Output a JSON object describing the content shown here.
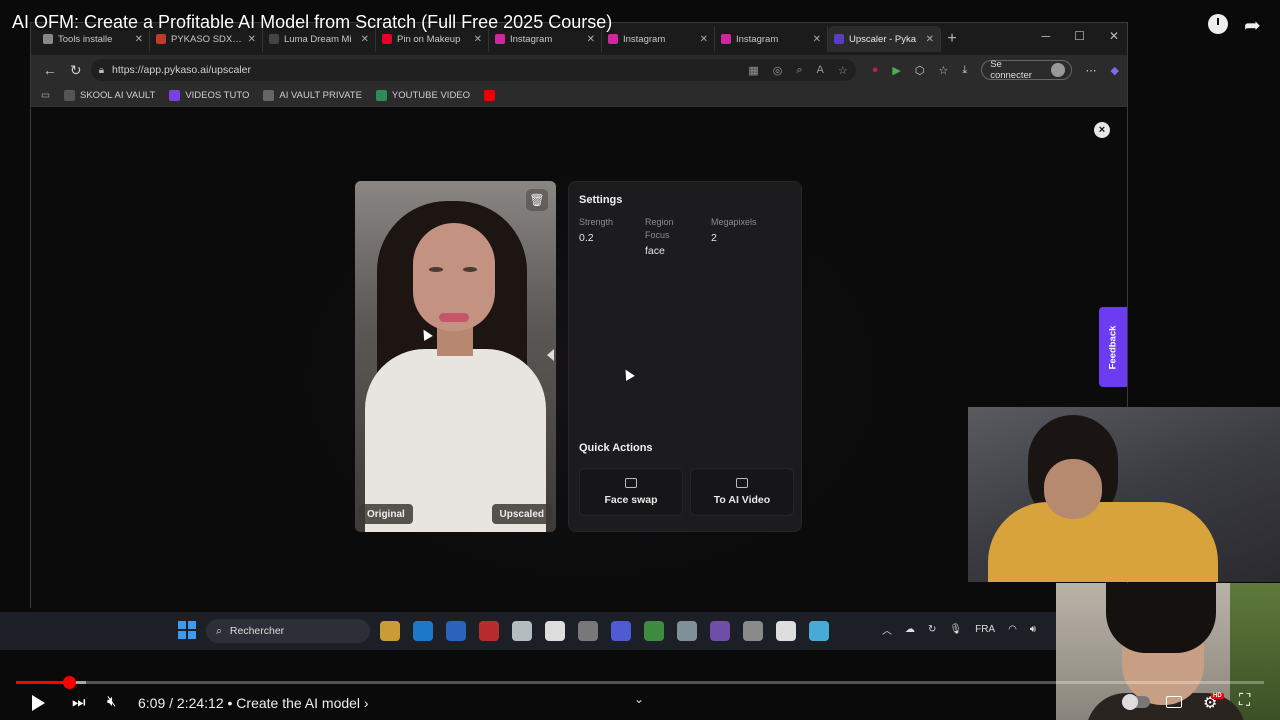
{
  "video": {
    "title": "AI OFM: Create a Profitable AI Model from Scratch (Full Free 2025 Course)",
    "time": "6:09 / 2:24:12 • Create the AI model ›",
    "progress_fraction": 0.0426,
    "buffer_fraction": 0.056,
    "hd_badge": "HD"
  },
  "browser": {
    "tabs": [
      {
        "label": "Tools installe",
        "color": "#888"
      },
      {
        "label": "PYKASO SDXL G",
        "color": "#c0392b"
      },
      {
        "label": "Luma Dream Mi",
        "color": "#444"
      },
      {
        "label": "Pin on Makeup",
        "color": "#e60023"
      },
      {
        "label": "Instagram",
        "color": "#d6249f"
      },
      {
        "label": "Instagram",
        "color": "#d6249f"
      },
      {
        "label": "Instagram",
        "color": "#d6249f"
      },
      {
        "label": "Upscaler - Pyka",
        "color": "#5b3cc4"
      }
    ],
    "url": "https://app.pykaso.ai/upscaler",
    "signin_label": "Se connecter",
    "bookmarks": [
      {
        "label": "SKOOL AI VAULT",
        "color": "#555"
      },
      {
        "label": "VIDEOS TUTO",
        "color": "#7b3fe4"
      },
      {
        "label": "AI VAULT PRIVATE",
        "color": "#666"
      },
      {
        "label": "YOUTUBE VIDEO",
        "color": "#2e8b57"
      },
      {
        "label": "",
        "color": "#e00"
      }
    ]
  },
  "upscaler": {
    "image_tags": {
      "original": "Original",
      "upscaled": "Upscaled"
    },
    "settings": {
      "title": "Settings",
      "strength_label": "Strength",
      "strength_value": "0.2",
      "region_label": "Region Focus",
      "region_value": "face",
      "megapixels_label": "Megapixels",
      "megapixels_value": "2"
    },
    "quick_actions": {
      "title": "Quick Actions",
      "face_swap": "Face swap",
      "ai_video": "To AI Video"
    },
    "feedback_label": "Feedback"
  },
  "taskbar": {
    "search_placeholder": "Rechercher",
    "language": "FRA",
    "apps": [
      "#e8b33a",
      "#1e88e5",
      "#2f6fd6",
      "#d32f2f",
      "#cfd8dc",
      "#ffffff",
      "#888",
      "#5865f2",
      "#43a047",
      "#90a4ae",
      "#7e57c2",
      "#9e9e9e",
      "#ffffff",
      "#4fc3f7"
    ]
  }
}
